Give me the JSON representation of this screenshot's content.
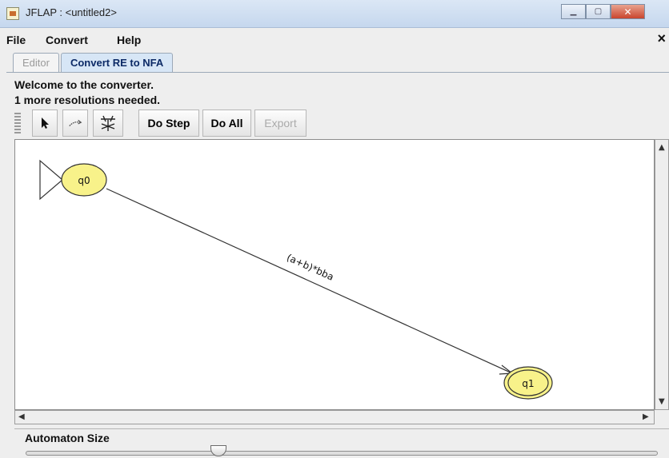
{
  "window": {
    "title": "JFLAP : <untitled2>",
    "controls": [
      "minimize",
      "maximize",
      "close"
    ]
  },
  "menu": {
    "items": [
      "File",
      "Convert",
      "Help"
    ],
    "close_label": "×"
  },
  "tabs": [
    {
      "label": "Editor",
      "active": false
    },
    {
      "label": "Convert RE to NFA",
      "active": true
    }
  ],
  "status": {
    "line1": "Welcome to the converter.",
    "line2": "1 more resolutions needed."
  },
  "toolbar": {
    "tools": [
      {
        "name": "attribute-editor-icon",
        "label": "",
        "enabled": true
      },
      {
        "name": "transition-tool-icon",
        "label": "",
        "enabled": true
      },
      {
        "name": "de-expressionify-icon",
        "label": "",
        "enabled": true
      },
      {
        "name": "do-step-button",
        "label": "Do Step",
        "enabled": true
      },
      {
        "name": "do-all-button",
        "label": "Do All",
        "enabled": true
      },
      {
        "name": "export-button",
        "label": "Export",
        "enabled": false
      }
    ]
  },
  "automaton": {
    "states": [
      {
        "id": "q0",
        "label": "q0",
        "initial": true,
        "final": false
      },
      {
        "id": "q1",
        "label": "q1",
        "initial": false,
        "final": true
      }
    ],
    "transitions": [
      {
        "from": "q0",
        "to": "q1",
        "label": "(a+b)*bba"
      }
    ],
    "colors": {
      "state_fill": "#f8f28a",
      "stroke": "#333333"
    }
  },
  "size_panel": {
    "label": "Automaton Size",
    "level": 0.3
  }
}
